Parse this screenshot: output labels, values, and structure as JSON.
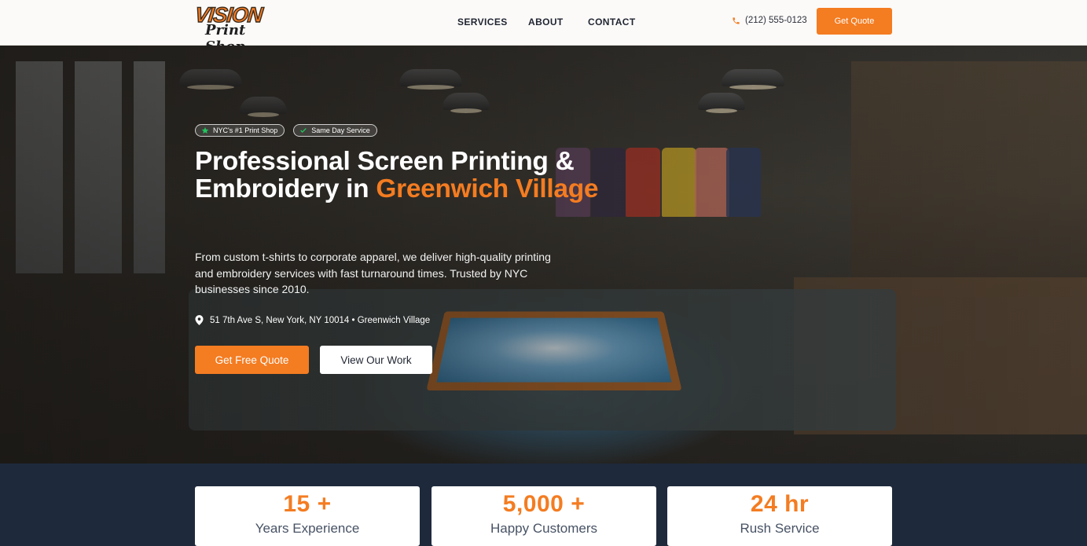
{
  "logo": {
    "line1": "VISION",
    "line2": "Print Shop"
  },
  "nav": {
    "links": [
      "SERVICES",
      "ABOUT",
      "CONTACT"
    ],
    "phone": "(212) 555-0123",
    "cta": "Get Quote"
  },
  "hero": {
    "badges": [
      {
        "icon": "star-icon",
        "text": "NYC's #1 Print Shop"
      },
      {
        "icon": "check-icon",
        "text": "Same Day Service"
      }
    ],
    "headline_main": "Professional Screen Printing & Embroidery in ",
    "headline_accent": "Greenwich Village",
    "subtitle": "From custom t-shirts to corporate apparel, we deliver high-quality printing and embroidery services with fast turnaround times. Trusted by NYC businesses since 2010.",
    "address": "51 7th Ave S, New York, NY 10014 • Greenwich Village",
    "primary_button": "Get Free Quote",
    "secondary_button": "View Our Work"
  },
  "stats": [
    {
      "value": "15 +",
      "label": "Years Experience"
    },
    {
      "value": "5,000 +",
      "label": "Happy Customers"
    },
    {
      "value": "24 hr",
      "label": "Rush Service"
    }
  ],
  "colors": {
    "accent": "#f47c21",
    "dark": "#1e293b"
  }
}
